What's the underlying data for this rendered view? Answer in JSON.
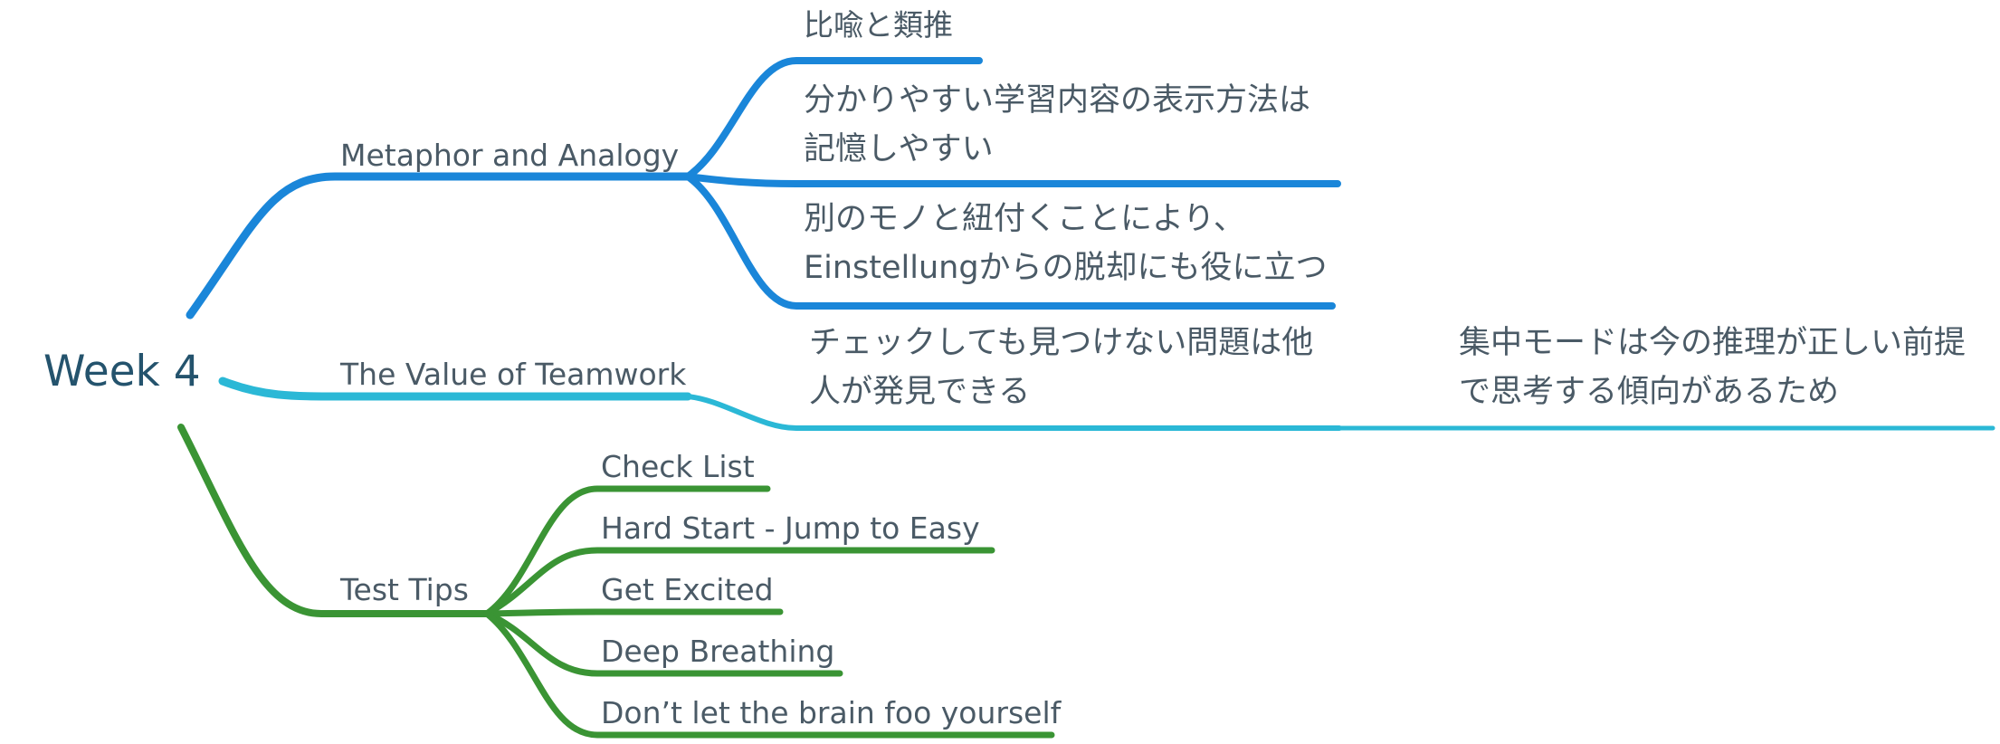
{
  "root": {
    "label": "Week 4"
  },
  "branches": {
    "metaphor": {
      "label": "Metaphor and Analogy",
      "color": "#1a86d9",
      "children": {
        "c0": {
          "line1": "比喩と類推"
        },
        "c1": {
          "line1": "分かりやすい学習内容の表示方法は",
          "line2": "記憶しやすい"
        },
        "c2": {
          "line1": "別のモノと紐付くことにより、",
          "line2": "Einstellungからの脱却にも役に立つ"
        }
      }
    },
    "teamwork": {
      "label": "The Value of Teamwork",
      "color": "#2bb8d6",
      "child": {
        "line1": "チェックしても見つけない問題は他",
        "line2": "人が発見できる",
        "grandchild": {
          "line1": "集中モードは今の推理が正しい前提",
          "line2": "で思考する傾向があるため"
        }
      }
    },
    "testtips": {
      "label": "Test Tips",
      "color": "#3a9434",
      "children": {
        "c0": {
          "label": "Check List"
        },
        "c1": {
          "label": "Hard Start - Jump to Easy"
        },
        "c2": {
          "label": "Get Excited"
        },
        "c3": {
          "label": "Deep Breathing"
        },
        "c4": {
          "label": "Don’t let the brain foo yourself"
        }
      }
    }
  }
}
